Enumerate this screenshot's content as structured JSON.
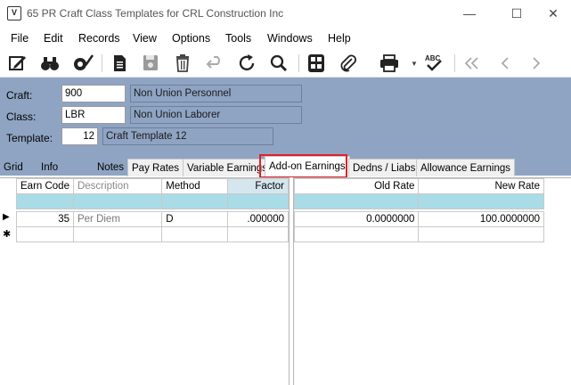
{
  "window": {
    "title": "65 PR Craft Class Templates for CRL Construction Inc",
    "app_icon_letter": "V",
    "minimize": "—",
    "maximize": "☐",
    "close": "✕"
  },
  "menu": [
    "File",
    "Edit",
    "Records",
    "View",
    "Options",
    "Tools",
    "Windows",
    "Help"
  ],
  "toolbar": {
    "icons": [
      "edit-notes-icon",
      "binoculars-icon",
      "settings-check-icon",
      "document-icon",
      "save-icon",
      "delete-icon",
      "undo-icon",
      "refresh-icon",
      "search-icon",
      "calculator-icon",
      "attachment-icon",
      "print-icon",
      "spellcheck-icon",
      "first-record-icon",
      "previous-record-icon",
      "next-record-icon"
    ],
    "spell_label": "ABC"
  },
  "header": {
    "craft_label": "Craft:",
    "craft_value": "900",
    "craft_desc": "Non Union Personnel",
    "class_label": "Class:",
    "class_value": "LBR",
    "class_desc": "Non Union Laborer",
    "template_label": "Template:",
    "template_value": "12",
    "template_desc": "Craft Template 12"
  },
  "tabs": {
    "grid": "Grid",
    "info": "Info",
    "notes": "Notes",
    "pay_rates": "Pay Rates",
    "variable_earnings": "Variable Earnings",
    "addon_earnings": "Add-on Earnings",
    "dedns_liabs": "Dedns / Liabs",
    "allowance_earnings": "Allowance Earnings"
  },
  "left_grid": {
    "headers": [
      "Earn Code",
      "Description",
      "Method",
      "Factor"
    ],
    "rows": [
      {
        "earn_code": "35",
        "description": "Per Diem",
        "method": "D",
        "factor": ".000000"
      }
    ]
  },
  "right_grid": {
    "headers": [
      "Old Rate",
      "New Rate"
    ],
    "rows": [
      {
        "old_rate": "0.0000000",
        "new_rate": "100.0000000"
      }
    ]
  },
  "row_markers": {
    "current": "▶",
    "new": "✱"
  },
  "colors": {
    "header_bg": "#8fa4c3",
    "filter_row": "#a9dce6",
    "highlight": "#e0202a"
  }
}
